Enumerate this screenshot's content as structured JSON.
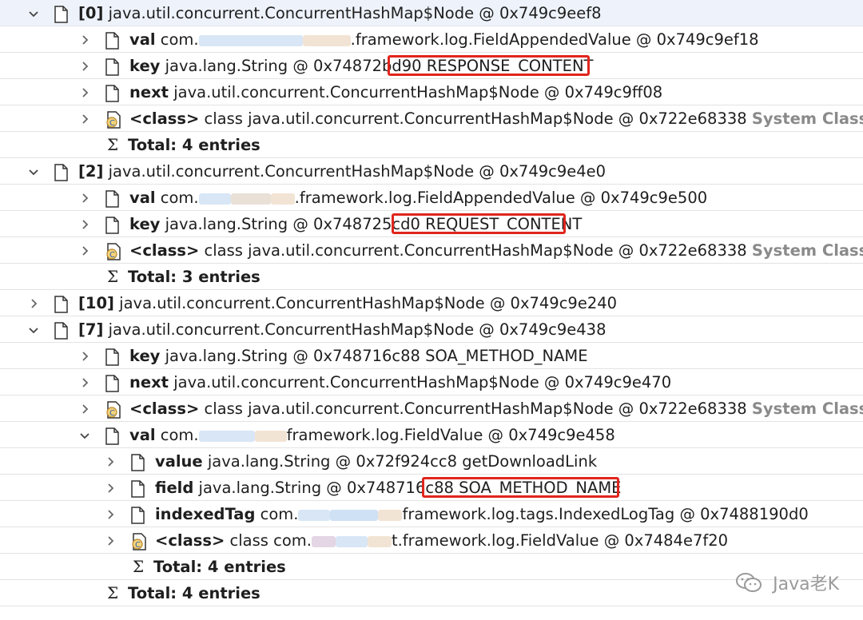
{
  "rows": [
    {
      "label": "[0]",
      "text": "java.util.concurrent.ConcurrentHashMap$Node @ 0x749c9eef8"
    },
    {
      "label": "val",
      "pre": "com.",
      "post": ".framework.log.FieldAppendedValue @ 0x749c9ef18"
    },
    {
      "label": "key",
      "text": "java.lang.String @ 0x74872bd90",
      "value": "RESPONSE_CONTENT"
    },
    {
      "label": "next",
      "text": "java.util.concurrent.ConcurrentHashMap$Node @ 0x749c9ff08"
    },
    {
      "label": "<class>",
      "text": "class java.util.concurrent.ConcurrentHashMap$Node @ 0x722e68338",
      "tag": "System Class"
    },
    {
      "label": "Total: 4 entries"
    },
    {
      "label": "[2]",
      "text": "java.util.concurrent.ConcurrentHashMap$Node @ 0x749c9e4e0"
    },
    {
      "label": "val",
      "pre": "com.",
      "post": ".framework.log.FieldAppendedValue @ 0x749c9e500"
    },
    {
      "label": "key",
      "text": "java.lang.String @ 0x748725cd0",
      "value": "REQUEST_CONTENT"
    },
    {
      "label": "<class>",
      "text": "class java.util.concurrent.ConcurrentHashMap$Node @ 0x722e68338",
      "tag": "System Class"
    },
    {
      "label": "Total: 3 entries"
    },
    {
      "label": "[10]",
      "text": "java.util.concurrent.ConcurrentHashMap$Node @ 0x749c9e240"
    },
    {
      "label": "[7]",
      "text": "java.util.concurrent.ConcurrentHashMap$Node @ 0x749c9e438"
    },
    {
      "label": "key",
      "text": "java.lang.String @ 0x748716c88",
      "value": "SOA_METHOD_NAME"
    },
    {
      "label": "next",
      "text": "java.util.concurrent.ConcurrentHashMap$Node @ 0x749c9e470"
    },
    {
      "label": "<class>",
      "text": "class java.util.concurrent.ConcurrentHashMap$Node @ 0x722e68338",
      "tag": "System Class"
    },
    {
      "label": "val",
      "pre": "com.",
      "post": "framework.log.FieldValue @ 0x749c9e458"
    },
    {
      "label": "value",
      "text": "java.lang.String @ 0x72f924cc8",
      "value": "getDownloadLink"
    },
    {
      "label": "field",
      "text": "java.lang.String @ 0x748716c88",
      "value": "SOA_METHOD_NAME"
    },
    {
      "label": "indexedTag",
      "pre": "com.",
      "post": "framework.log.tags.IndexedLogTag @ 0x7488190d0"
    },
    {
      "label": "<class>",
      "pre": "class com.",
      "post": "t.framework.log.FieldValue @ 0x7484e7f20"
    },
    {
      "label": "Total: 4 entries"
    },
    {
      "label": "Total: 4 entries"
    }
  ],
  "watermark": {
    "text": "Java老K",
    "icon": "wechat-icon"
  },
  "colors": {
    "highlight_box": "#e0261d",
    "system_class": "#8a8a8a"
  }
}
